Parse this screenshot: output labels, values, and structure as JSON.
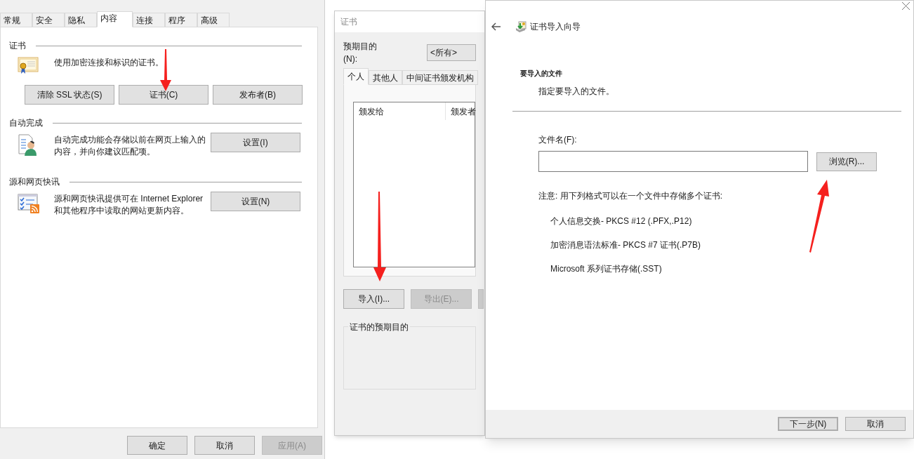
{
  "internet_options": {
    "tabs": [
      {
        "label": "常规",
        "selected": false
      },
      {
        "label": "安全",
        "selected": false
      },
      {
        "label": "隐私",
        "selected": false
      },
      {
        "label": "内容",
        "selected": true
      },
      {
        "label": "连接",
        "selected": false
      },
      {
        "label": "程序",
        "selected": false
      },
      {
        "label": "高级",
        "selected": false
      }
    ],
    "sections": [
      {
        "kind": "buttons_below",
        "title": "证书",
        "text": "使用加密连接和标识的证书。",
        "buttons": [
          "清除 SSL 状态(S)",
          "证书(C)",
          "发布者(B)"
        ]
      },
      {
        "kind": "button_right",
        "title": "自动完成",
        "text": "自动完成功能会存储以前在网页上输入的内容，并向你建议匹配项。",
        "buttons": [
          "设置(I)"
        ]
      },
      {
        "kind": "button_right",
        "title": "源和网页快讯",
        "text": "源和网页快讯提供可在 Internet Explorer 和其他程序中读取的网站更新内容。",
        "buttons": [
          "设置(N)"
        ]
      }
    ],
    "buttons": [
      {
        "label": "确定",
        "disabled": false
      },
      {
        "label": "取消",
        "disabled": false
      },
      {
        "label": "应用(A)",
        "disabled": true
      }
    ]
  },
  "certificates_dialog": {
    "title": "证书",
    "purpose_label": "预期目的(N):",
    "purpose_value": "<所有>",
    "tabs": [
      {
        "label": "个人",
        "selected": true
      },
      {
        "label": "其他人",
        "selected": false
      },
      {
        "label": "中间证书颁发机构",
        "selected": false
      }
    ],
    "columns": [
      "颁发给",
      "颁发者"
    ],
    "buttons": [
      {
        "label": "导入(I)...",
        "disabled": false
      },
      {
        "label": "导出(E)...",
        "disabled": true
      }
    ],
    "group_title": "证书的预期目的"
  },
  "import_wizard": {
    "title": "证书导入向导",
    "heading": "要导入的文件",
    "subheading": "指定要导入的文件。",
    "file_label": "文件名(F):",
    "browse_button": "浏览(R)...",
    "note": "注意: 用下列格式可以在一个文件中存储多个证书:",
    "formats": [
      "个人信息交换- PKCS #12 (.PFX,.P12)",
      "加密消息语法标准- PKCS #7 证书(.P7B)",
      "Microsoft 系列证书存储(.SST)"
    ],
    "buttons": [
      {
        "label": "下一步(N)",
        "default": true
      },
      {
        "label": "取消",
        "default": false
      }
    ]
  }
}
